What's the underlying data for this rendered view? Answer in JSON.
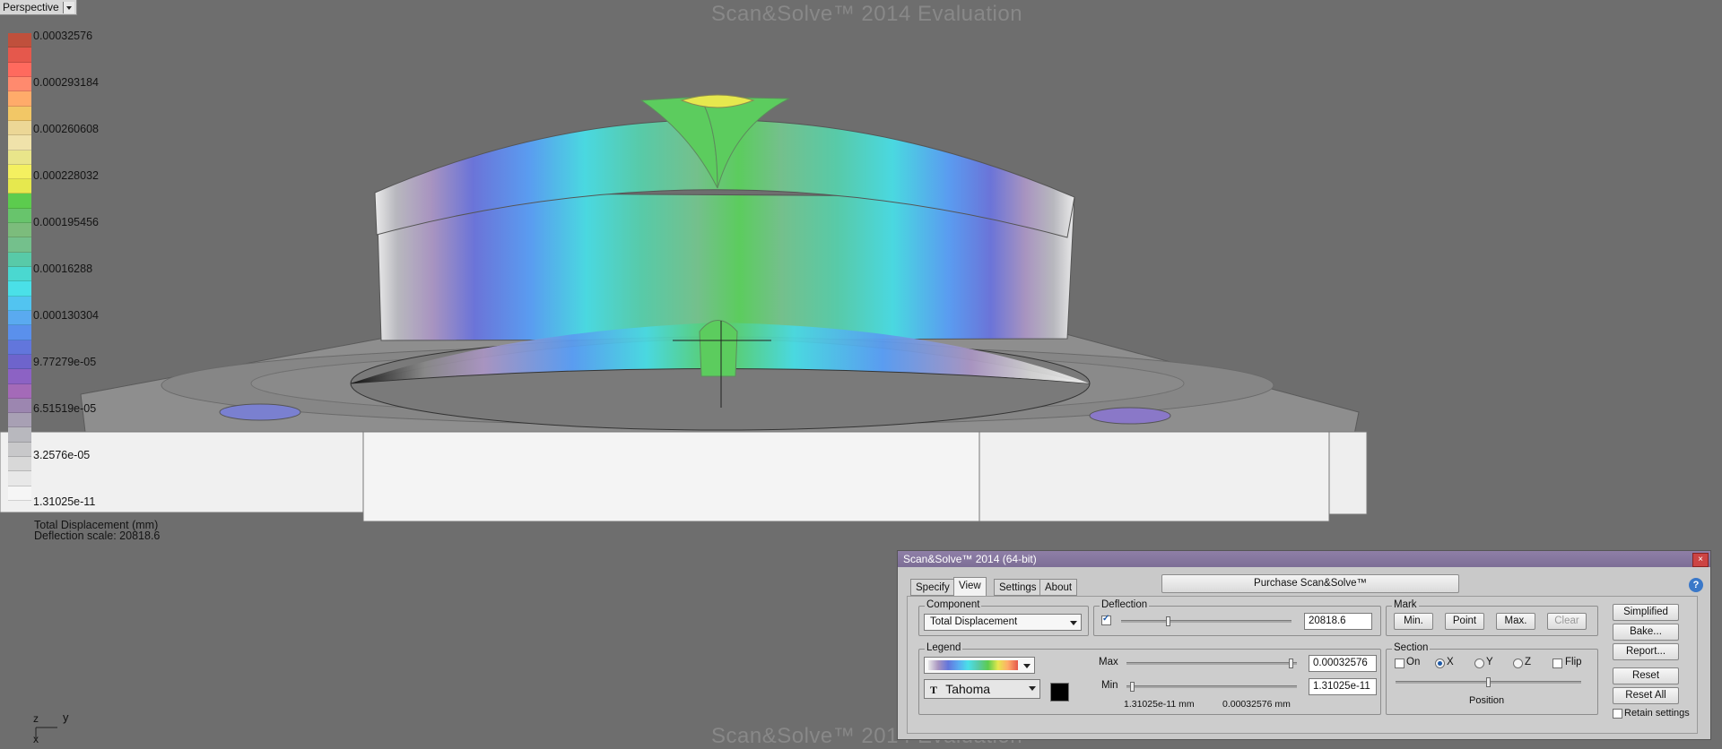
{
  "viewport": {
    "label": "Perspective",
    "watermark": "Scan&Solve™ 2014 Evaluation",
    "legend": {
      "colors": [
        "#c0503c",
        "#e5584c",
        "#ff6a5e",
        "#ff8a6e",
        "#ffab6a",
        "#f2c766",
        "#ecd796",
        "#f0e2aa",
        "#e9e58a",
        "#f4f060",
        "#e6e84e",
        "#5ccc4e",
        "#68c46c",
        "#7cbc7c",
        "#74c08c",
        "#58caa8",
        "#4ad8d0",
        "#4ae0e8",
        "#52c4f0",
        "#5aaaf0",
        "#5a90ec",
        "#6276dc",
        "#6e64cc",
        "#8c62c4",
        "#a46ab8",
        "#9c86b0",
        "#a8a0b4",
        "#b8b8be",
        "#c8c8ca",
        "#d8d8d8",
        "#e8e8e8",
        "#f6f6f6"
      ],
      "labels": [
        "0.00032576",
        "0.000293184",
        "0.000260608",
        "0.000228032",
        "0.000195456",
        "0.00016288",
        "0.000130304",
        "9.77279e-05",
        "6.51519e-05",
        "3.2576e-05",
        "1.31025e-11"
      ],
      "caption_line1": "Total Displacement (mm)",
      "caption_line2": "Deflection scale: 20818.6"
    },
    "axes": {
      "z": "z",
      "y": "y",
      "x": "x"
    }
  },
  "panel": {
    "title": "Scan&Solve™ 2014 (64-bit)",
    "close_glyph": "×",
    "help_glyph": "?",
    "tabs": [
      "Specify",
      "View",
      "Settings",
      "About"
    ],
    "active_tab": "View",
    "purchase_label": "Purchase Scan&Solve™",
    "component": {
      "title": "Component",
      "value": "Total Displacement"
    },
    "deflection": {
      "title": "Deflection",
      "checked": true,
      "value": "20818.6",
      "slider_fraction": 0.27
    },
    "mark": {
      "title": "Mark",
      "min": "Min.",
      "point": "Point",
      "max": "Max.",
      "clear": "Clear"
    },
    "legend": {
      "title": "Legend",
      "font_icon": "T",
      "font": "Tahoma",
      "max_label": "Max",
      "min_label": "Min",
      "max_value": "0.00032576",
      "min_value": "1.31025e-11",
      "range_min": "1.31025e-11 mm",
      "range_max": "0.00032576 mm",
      "max_fraction": 0.98,
      "min_fraction": 0.02
    },
    "section": {
      "title": "Section",
      "on": "On",
      "x": "X",
      "y": "Y",
      "z": "Z",
      "flip": "Flip",
      "selected_axis": "X",
      "position_label": "Position",
      "position_fraction": 0.5
    },
    "side_buttons": {
      "simplified": "Simplified",
      "bake": "Bake...",
      "report": "Report...",
      "reset": "Reset",
      "reset_all": "Reset All",
      "retain": "Retain settings"
    }
  }
}
